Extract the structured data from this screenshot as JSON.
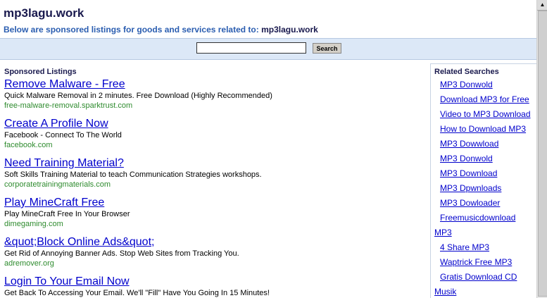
{
  "header": {
    "site_title": "mp3lagu.work",
    "subtitle_prefix": "Below are sponsored listings for goods and services related to:",
    "subtitle_domain": "mp3lagu.work"
  },
  "search": {
    "value": "",
    "button_label": "Search"
  },
  "listings": {
    "heading": "Sponsored Listings",
    "items": [
      {
        "title": "Remove Malware - Free",
        "desc": "Quick Malware Removal in 2 minutes. Free Download (Highly Recommended)",
        "url": "free-malware-removal.sparktrust.com"
      },
      {
        "title": "Create A Profile Now",
        "desc": "Facebook - Connect To The World",
        "url": "facebook.com"
      },
      {
        "title": "Need Training Material?",
        "desc": "Soft Skills Training Material to teach Communication Strategies workshops.",
        "url": "corporatetrainingmaterials.com"
      },
      {
        "title": "Play MineCraft Free",
        "desc": "Play MineCraft Free In Your Browser",
        "url": "dimegaming.com"
      },
      {
        "title": "&quot;Block Online Ads&quot;",
        "desc": "Get Rid of Annoying Banner Ads. Stop Web Sites from Tracking You.",
        "url": "adremover.org"
      },
      {
        "title": "Login To Your Email Now",
        "desc": "Get Back To Accessing Your Email. We'll \"Fill\" Have You Going In 15 Minutes!",
        "url": ""
      }
    ]
  },
  "related": {
    "heading": "Related Searches",
    "items": [
      "MP3 Donwold",
      "Download MP3 for Free",
      "Video to MP3 Download",
      "How to Download MP3",
      "MP3 Dowwload",
      "MP3 Donwold",
      "MP3 Download",
      "MP3 Dpwnloads",
      "MP3 Dowloader",
      "Freemusicdownload",
      "MP3",
      "4 Share MP3",
      "Waptrick Free MP3",
      "Gratis Download CD",
      "Musik"
    ]
  },
  "scrollbar": {
    "up_arrow": "▲"
  }
}
